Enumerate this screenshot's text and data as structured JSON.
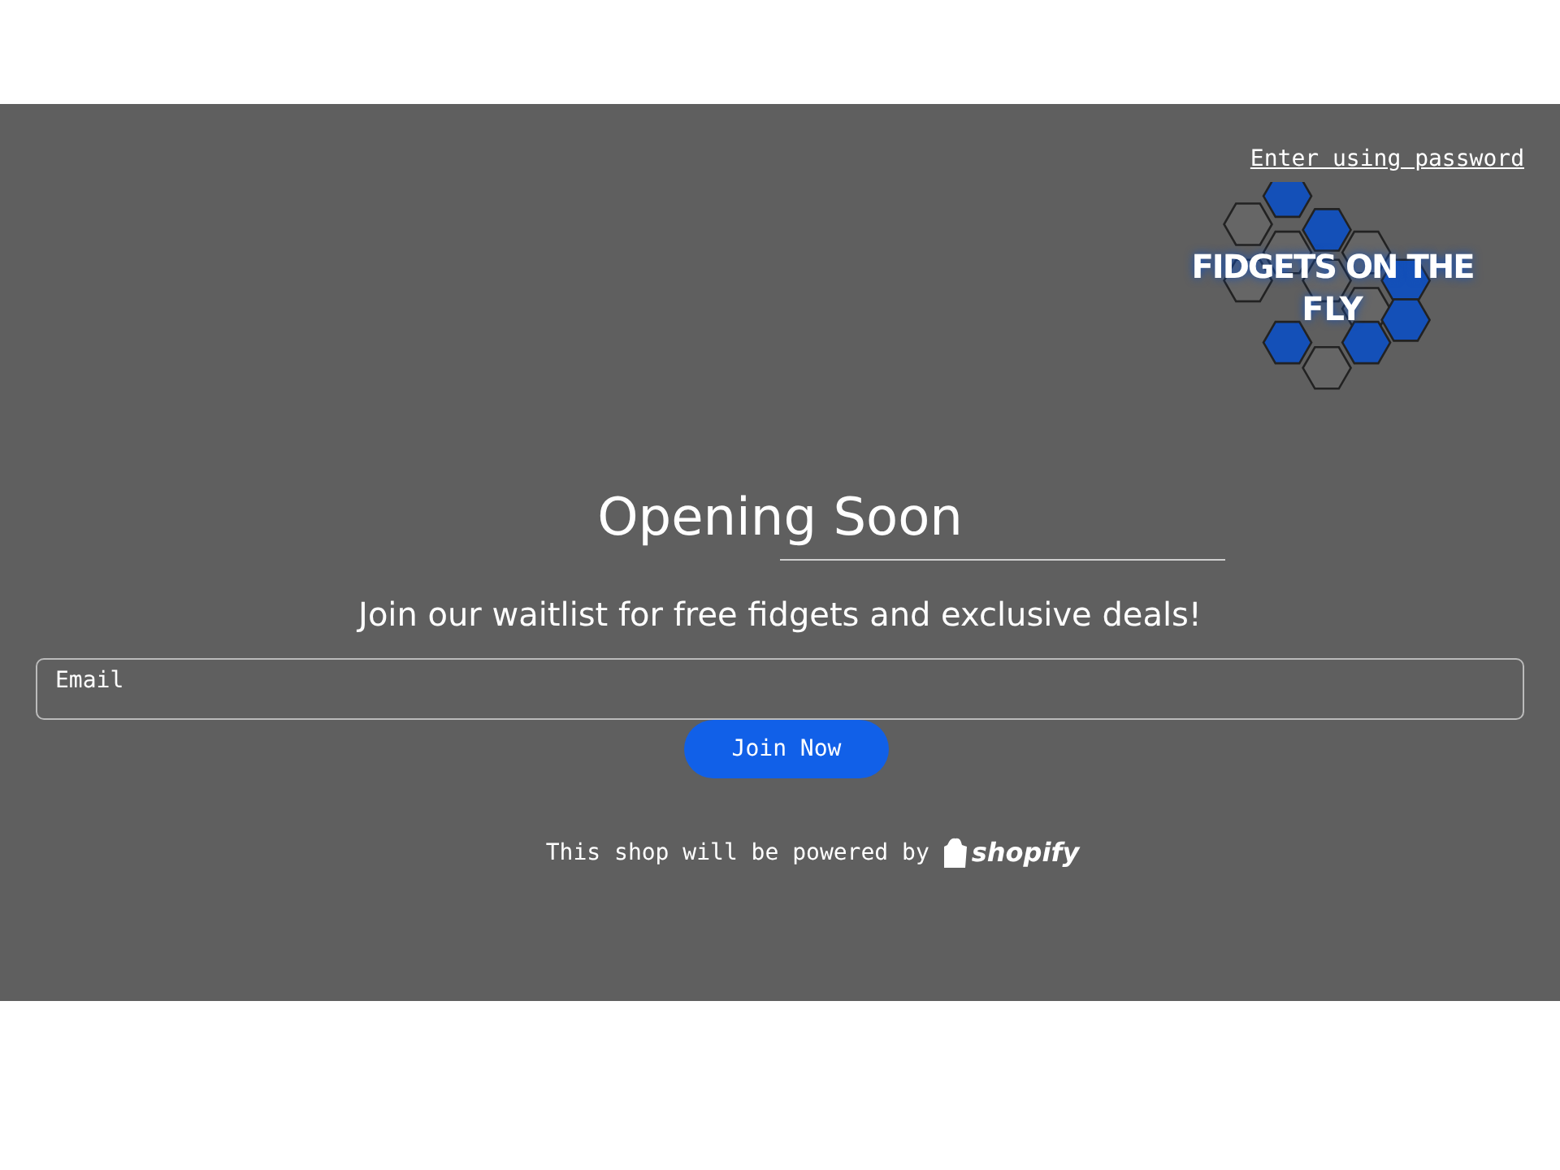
{
  "header_link": "Enter using password",
  "logo": {
    "line_1": "FIDGETS ON THE",
    "line_2": "FLY"
  },
  "title": "Opening Soon",
  "subtitle": "Join our waitlist for free fidgets and exclusive deals!",
  "email_field": {
    "placeholder": "Email"
  },
  "submit_button": "Join Now",
  "footer": {
    "text": "This shop will be powered by",
    "brand": "shopify"
  }
}
